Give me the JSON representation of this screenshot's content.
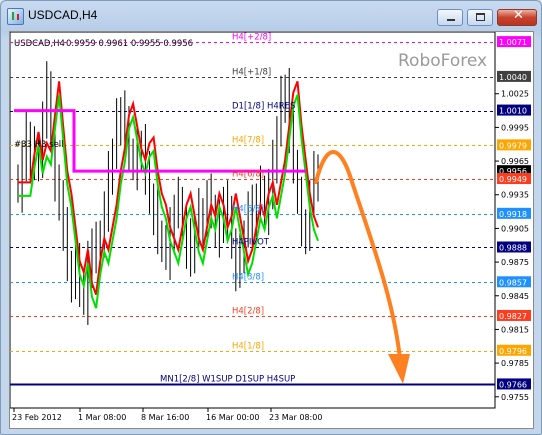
{
  "window": {
    "title": "USDCAD,H4",
    "icons": [
      "chart-window-icon",
      "minimize-icon",
      "maximize-icon",
      "close-icon"
    ],
    "close_glyph": "✕"
  },
  "chart_header": {
    "symbol": "USDCAD,H4",
    "ohlc": "0.9959 0.9961 0.9955 0.9956"
  },
  "watermark": "RoboForex",
  "price_axis": {
    "labels": [
      "1.0025",
      "0.9995",
      "0.9965",
      "0.9935",
      "0.9905",
      "0.9875",
      "0.9845",
      "0.9815",
      "0.9785",
      "0.9755"
    ],
    "badges": [
      {
        "value": "1.0071",
        "bg": "#ff00ff",
        "fg": "#ffffff"
      },
      {
        "value": "1.0040",
        "bg": "#404040",
        "fg": "#ffffff"
      },
      {
        "value": "1.0010",
        "bg": "#000080",
        "fg": "#ffffff"
      },
      {
        "value": "0.9979",
        "bg": "#ffa500",
        "fg": "#ffffff"
      },
      {
        "value": "0.9956",
        "bg": "#000000",
        "fg": "#ffffff"
      },
      {
        "value": "0.9949",
        "bg": "#ff3c1e",
        "fg": "#ffffff"
      },
      {
        "value": "0.9918",
        "bg": "#1e90ff",
        "fg": "#ffffff"
      },
      {
        "value": "0.9888",
        "bg": "#000080",
        "fg": "#ffffff"
      },
      {
        "value": "0.9857",
        "bg": "#1e90ff",
        "fg": "#ffffff"
      },
      {
        "value": "0.9827",
        "bg": "#ff3c1e",
        "fg": "#ffffff"
      },
      {
        "value": "0.9796",
        "bg": "#ffa500",
        "fg": "#ffffff"
      },
      {
        "value": "0.9766",
        "bg": "#000080",
        "fg": "#ffffff"
      }
    ]
  },
  "time_axis": {
    "labels": [
      "23 Feb 2012",
      "1 Mar 08:00",
      "8 Mar 16:00",
      "16 Mar 00:00",
      "23 Mar 08:00"
    ]
  },
  "levels": [
    {
      "label": "H4[+2/8]",
      "price": 1.0071,
      "color": "#ff00ff"
    },
    {
      "label": "H4[+1/8]",
      "price": 1.004,
      "color": "#404040"
    },
    {
      "label": "D1[1/8] H4RES",
      "price": 1.001,
      "color": "#000080"
    },
    {
      "label": "H4[7/8]",
      "price": 0.9979,
      "color": "#ffa500"
    },
    {
      "label": "H4[6/8]",
      "price": 0.9949,
      "color": "#ff3c1e"
    },
    {
      "label": "H4[5/8]",
      "price": 0.9918,
      "color": "#1e90ff"
    },
    {
      "label": "H4PIVOT",
      "price": 0.9888,
      "color": "#000080"
    },
    {
      "label": "H4[3/8]",
      "price": 0.9857,
      "color": "#1e90ff"
    },
    {
      "label": "H4[2/8]",
      "price": 0.9827,
      "color": "#ff3c1e"
    },
    {
      "label": "H4[1/8]",
      "price": 0.9796,
      "color": "#ffa500"
    },
    {
      "label": "MN1[2/8] W1SUP D1SUP H4SUP",
      "price": 0.9766,
      "color": "#000080"
    }
  ],
  "indicator_label": "#33 H3 sell",
  "colors": {
    "candles": "#000000",
    "green_line": "#00e000",
    "red_line": "#ff0000",
    "magenta_line": "#ff00ff",
    "arrow": "#ff8020",
    "dotted_red_hline": "#ff3c1e"
  },
  "chart_data": {
    "type": "candlestick",
    "ylim": [
      0.9745,
      1.008
    ],
    "price_labels_step": 0.003,
    "last_price": 0.9956,
    "close_series": [
      0.994,
      0.9965,
      0.9985,
      0.996,
      0.9975,
      0.9968,
      1.0,
      1.003,
      0.999,
      0.995,
      0.993,
      0.99,
      0.987,
      0.986,
      0.988,
      0.985,
      0.984,
      0.987,
      0.989,
      0.988,
      0.99,
      0.992,
      0.995,
      0.997,
      1.0,
      1.001,
      0.999,
      0.997,
      0.996,
      0.9975,
      0.998,
      0.995,
      0.993,
      0.992,
      0.99,
      0.989,
      0.988,
      0.99,
      0.992,
      0.993,
      0.991,
      0.989,
      0.988,
      0.99,
      0.992,
      0.991,
      0.993,
      0.992,
      0.99,
      0.991,
      0.993,
      0.991,
      0.989,
      0.987,
      0.988,
      0.99,
      0.992,
      0.991,
      0.993,
      0.994,
      0.992,
      0.994,
      0.996,
      0.999,
      1.002,
      1.003,
      0.999,
      0.996,
      0.993,
      0.991,
      0.99,
      0.993,
      0.995,
      0.9956
    ]
  }
}
